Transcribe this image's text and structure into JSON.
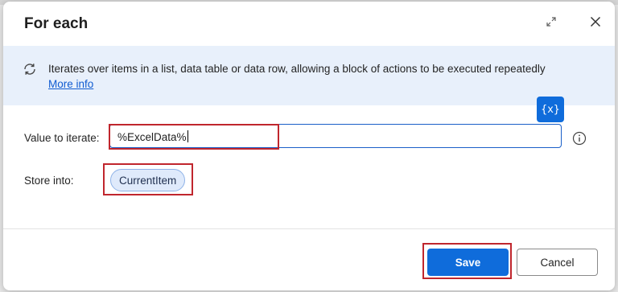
{
  "dialog": {
    "title": "For each"
  },
  "info": {
    "description": "Iterates over items in a list, data table or data row, allowing a block of actions to be executed repeatedly",
    "more_info": "More info"
  },
  "fields": {
    "value_label": "Value to iterate:",
    "value": "%ExcelData%",
    "variable_button": "{x}",
    "store_label": "Store into:",
    "store_variable": "CurrentItem"
  },
  "footer": {
    "save_label": "Save",
    "cancel_label": "Cancel"
  },
  "icons": {
    "expand": "expand-icon",
    "close": "close-icon",
    "loop": "loop-icon",
    "info": "info-icon"
  },
  "colors": {
    "accent": "#0f6cdb",
    "info_band": "#e8f0fb",
    "highlight": "#c0262d",
    "chip_bg": "#dfeafb"
  }
}
